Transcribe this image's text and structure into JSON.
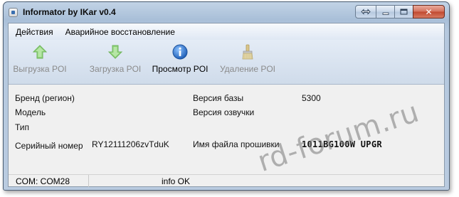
{
  "window": {
    "title": "Informator by IKar v0.4",
    "caption_buttons": {
      "restore": "restore-icon",
      "minimize": "minimize-icon",
      "maximize": "maximize-icon",
      "close": "close-icon",
      "close_glyph": "✕"
    }
  },
  "menu": {
    "items": [
      "Действия",
      "Аварийное восстановление"
    ]
  },
  "toolbar": {
    "buttons": [
      {
        "label": "Выгрузка POI",
        "icon": "arrow-up-icon",
        "enabled": false
      },
      {
        "label": "Загрузка POI",
        "icon": "arrow-down-icon",
        "enabled": false
      },
      {
        "label": "Просмотр POI",
        "icon": "info-icon",
        "enabled": true
      },
      {
        "label": "Удаление POI",
        "icon": "brush-icon",
        "enabled": false
      }
    ]
  },
  "info": {
    "brand_label": "Бренд (регион)",
    "model_label": "Модель",
    "type_label": "Тип",
    "serial_label": "Серийный номер",
    "serial_value": "RY12111206zvTduK",
    "db_version_label": "Версия базы",
    "db_version_value": "5300",
    "voice_version_label": "Версия озвучки",
    "firmware_label": "Имя файла прошивки",
    "firmware_value": "1011BG100W  UPGR"
  },
  "status": {
    "port": "COM: COM28",
    "info": "info OK"
  },
  "watermark": "rd-forum.ru",
  "colors": {
    "titlebar": "#b9cbe0",
    "close_button": "#c0482f",
    "arrow_green": "#5bbf3e",
    "info_blue": "#2d73c9"
  }
}
